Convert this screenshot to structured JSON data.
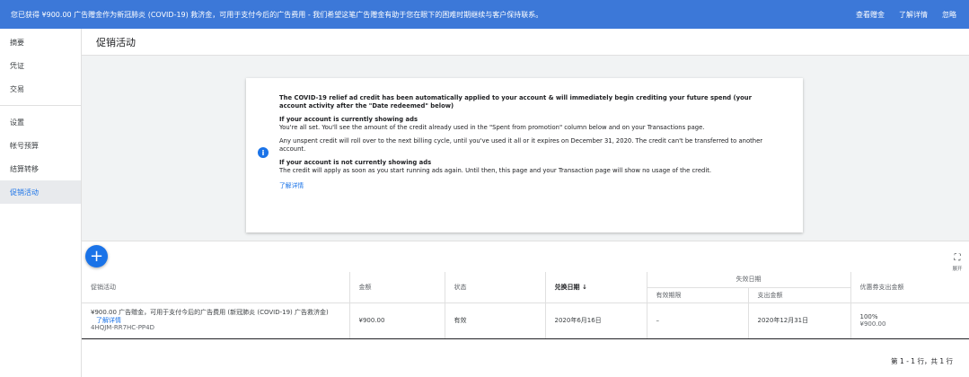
{
  "banner": {
    "message": "您已获得 ¥900.00 广告赠金作为新冠肺炎 (COVID-19) 救济金，可用于支付今后的广告费用 - 我们希望这笔广告赠金有助于您在眼下的困难时期继续与客户保持联系。",
    "view_credit": "查看赠金",
    "learn_more": "了解详情",
    "dismiss": "忽略"
  },
  "sidebar": {
    "items": [
      "摘要",
      "凭证",
      "交易",
      "设置",
      "帐号预算",
      "结算转移",
      "促销活动"
    ]
  },
  "page_title": "促销活动",
  "info_card": {
    "heading": "The COVID-19 relief ad credit has been automatically applied to your account & will immediately begin crediting your future spend (your account activity after the \"Date redeemed\" below)",
    "showing_title": "If your account is currently showing ads",
    "showing_body": "You're all set. You'll see the amount of the credit already used in the \"Spent from promotion\" column below and on your Transactions page.",
    "rollover": "Any unspent credit will roll over to the next billing cycle, until you've used it all or it expires on December 31, 2020. The credit can't be transferred to another account.",
    "not_showing_title": "If your account is not currently showing ads",
    "not_showing_body": "The credit will apply as soon as you start running ads again. Until then, this page and your Transaction page will show no usage of the credit.",
    "learn_more": "了解详情"
  },
  "table": {
    "expand_label": "展开",
    "headers": {
      "promotion": "促销活动",
      "amount": "金额",
      "status": "状态",
      "redeemed": "兑换日期",
      "expiry_group": "失效日期",
      "validity": "有效期限",
      "spend_amount": "支出金额",
      "coupon_spend": "优惠券支出金额"
    },
    "rows": [
      {
        "name": "¥900.00 广告赠金，可用于支付今后的广告费用 (新冠肺炎 (COVID-19) 广告救济金)",
        "link": "了解详情",
        "id": "4HQJM-RR7HC-PP4D",
        "amount": "¥900.00",
        "status": "有效",
        "redeemed": "2020年6月16日",
        "validity": "–",
        "spend_amount": "2020年12月31日",
        "coupon_pct": "100%",
        "coupon_amount": "¥900.00"
      }
    ],
    "pagination": "第 1 - 1 行，共 1 行"
  }
}
